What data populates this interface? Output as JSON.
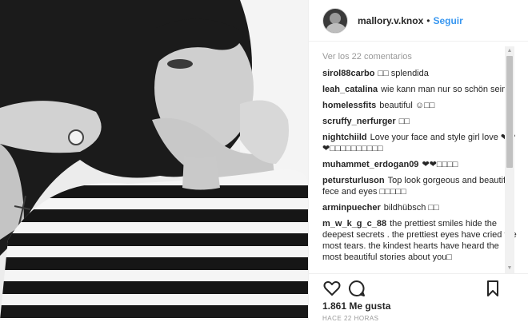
{
  "post": {
    "username": "mallory.v.knox",
    "separator": "•",
    "follow_label": "Seguir"
  },
  "comments": {
    "view_all": "Ver los 22 comentarios",
    "items": [
      {
        "user": "sirol88carbo",
        "text": "□□ splendida"
      },
      {
        "user": "leah_catalina",
        "text": "wie kann man nur so schön sein ?"
      },
      {
        "user": "homelessfits",
        "text": "beautiful ☺□□"
      },
      {
        "user": "scruffy_nerfurger",
        "text": "□□"
      },
      {
        "user": "nightchiild",
        "text": "Love your face and style girl love ❤❤❤□□□□□□□□□□"
      },
      {
        "user": "muhammet_erdogan09",
        "text": "❤❤□□□□"
      },
      {
        "user": "petursturluson",
        "text": "Top look gorgeous and beautiful fece and eyes □□□□□"
      },
      {
        "user": "arminpuecher",
        "text": "bildhübsch □□"
      },
      {
        "user": "m_w_k_g_c_88",
        "text": "the prettiest smiles hide the deepest secrets . the prettiest eyes have cried the most tears. the kindest hearts have heard the most beautiful stories about you□"
      }
    ]
  },
  "icons": {
    "like": "heart-icon",
    "comment": "comment-icon",
    "save": "bookmark-icon"
  },
  "stats": {
    "likes": "1.861 Me gusta",
    "time": "HACE 22 HORAS"
  },
  "colors": {
    "link": "#3897f0",
    "muted": "#999999",
    "text": "#262626"
  }
}
